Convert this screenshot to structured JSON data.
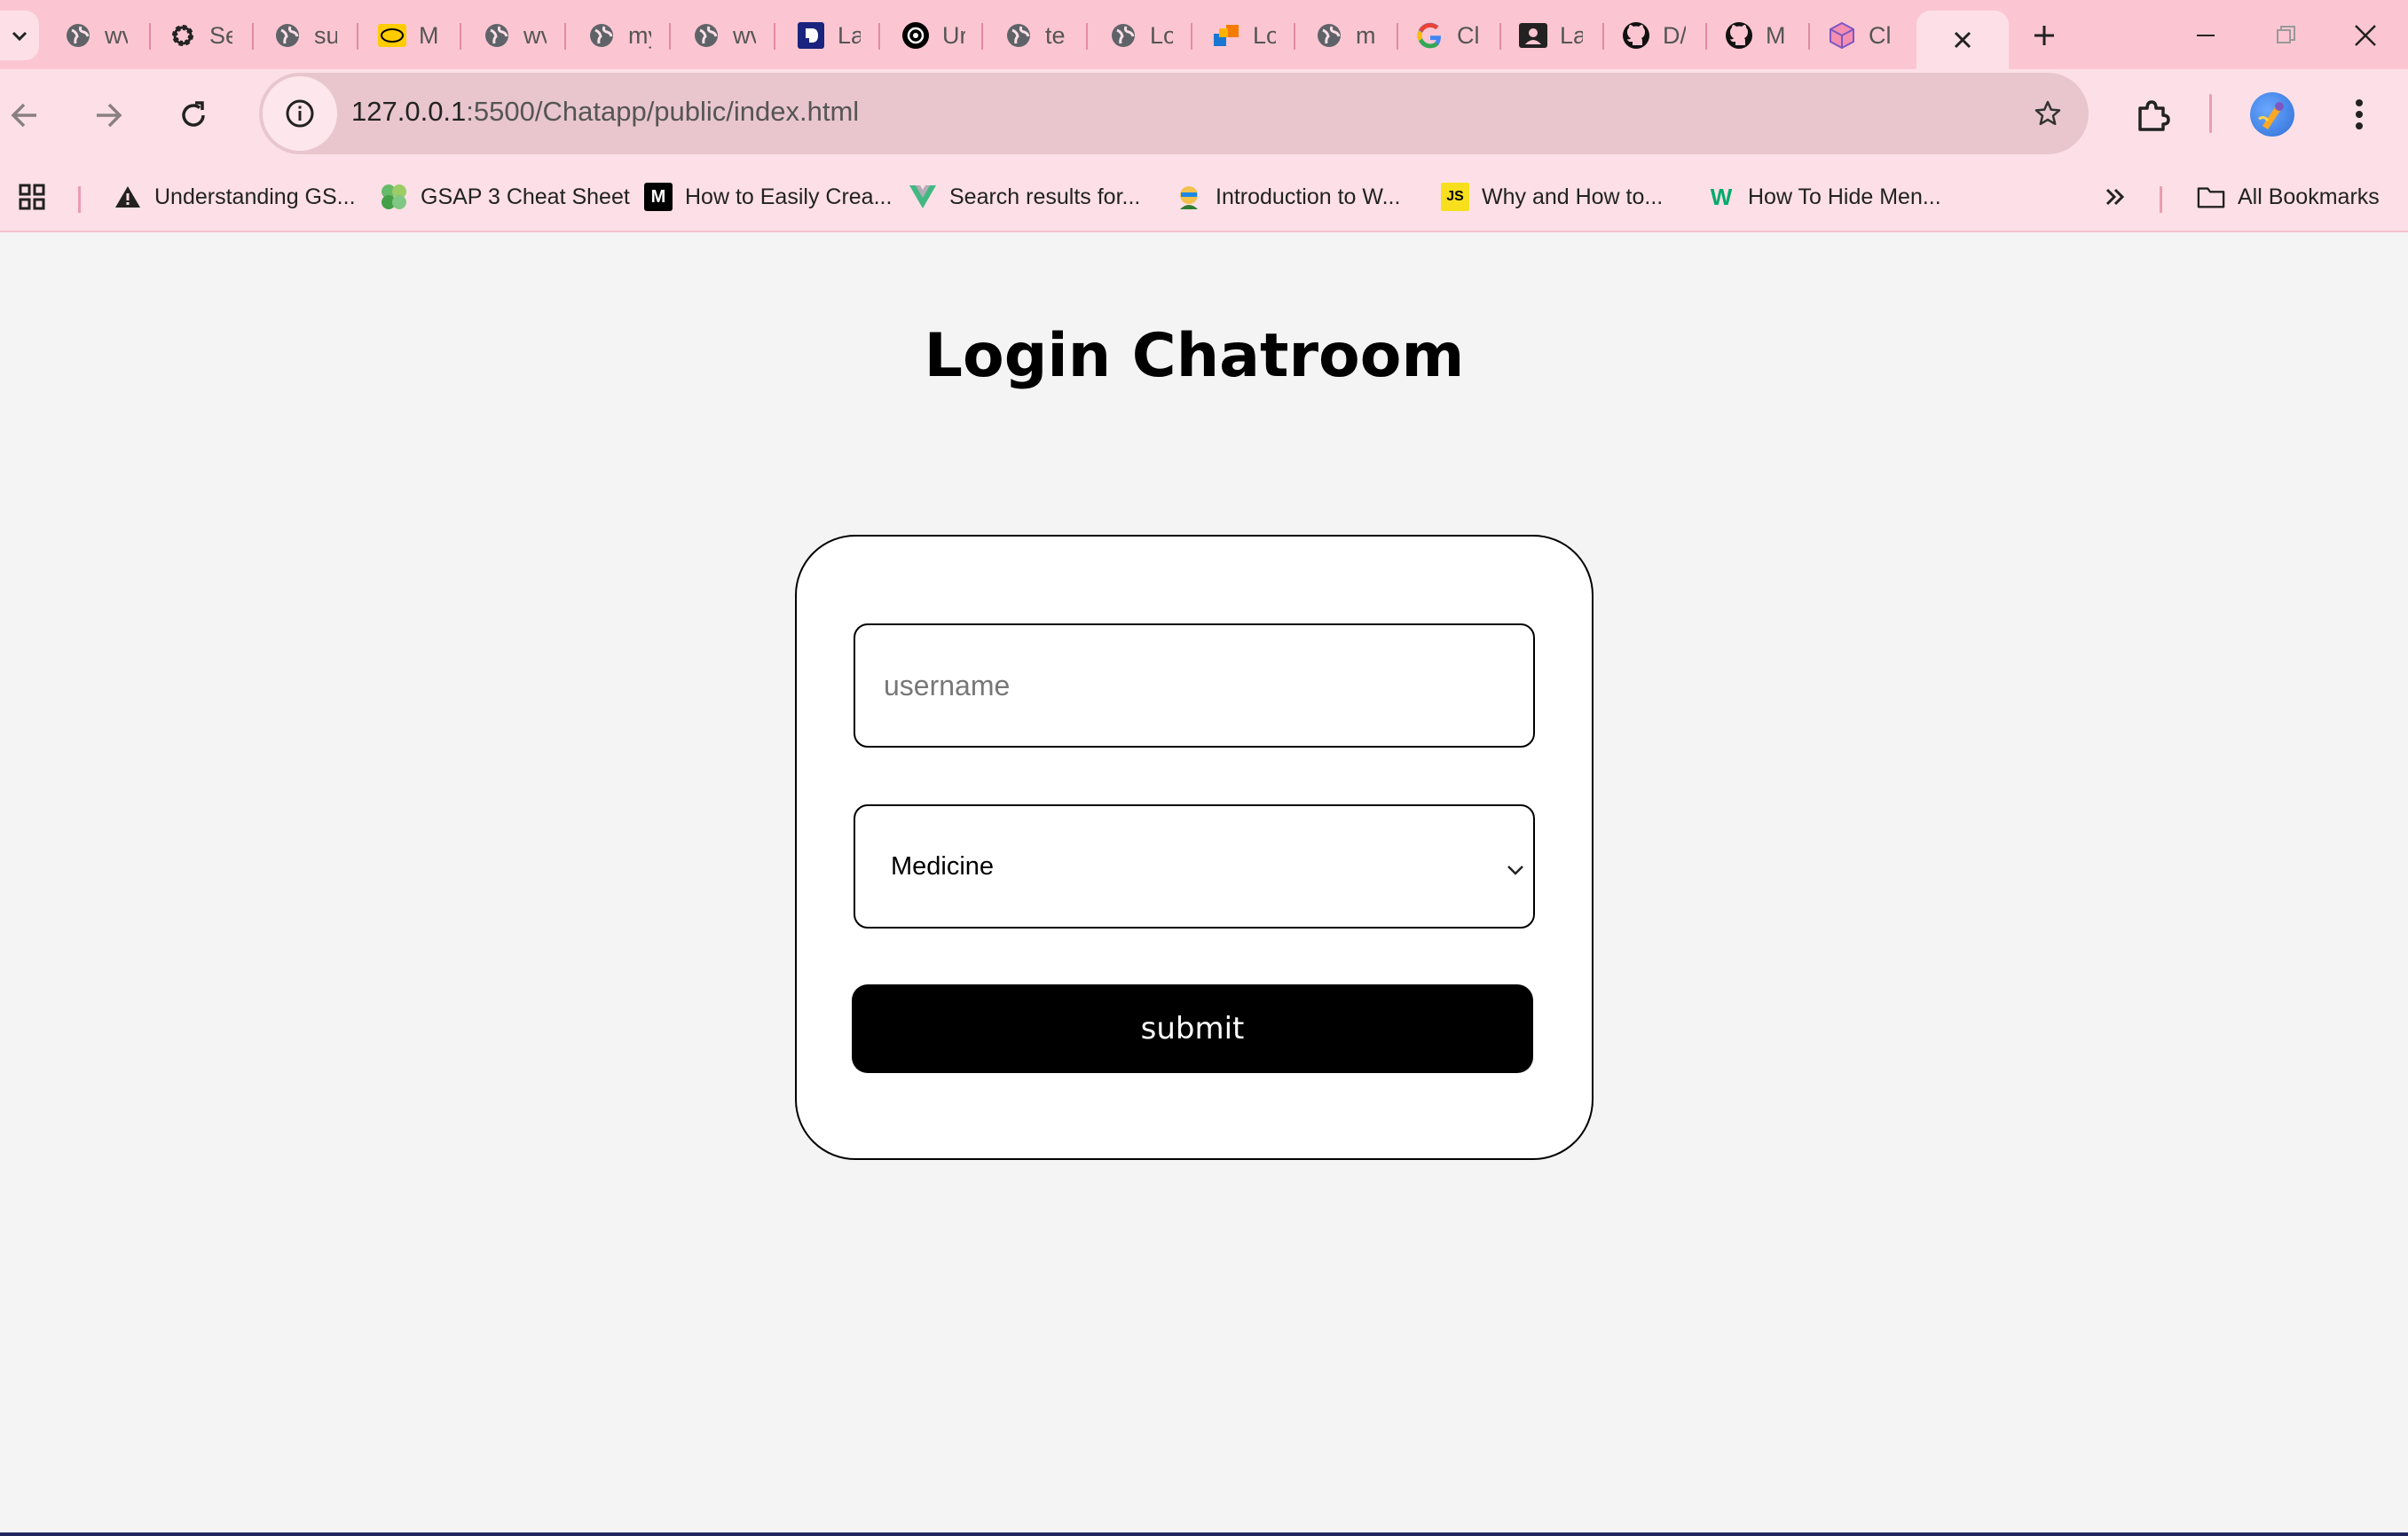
{
  "browser": {
    "tabs": [
      {
        "title": "wv",
        "icon": "globe-icon"
      },
      {
        "title": "Se",
        "icon": "gear-icon"
      },
      {
        "title": "su",
        "icon": "globe-icon"
      },
      {
        "title": "M",
        "icon": "mtn-icon"
      },
      {
        "title": "wv",
        "icon": "globe-icon"
      },
      {
        "title": "my",
        "icon": "globe-icon"
      },
      {
        "title": "wv",
        "icon": "globe-icon"
      },
      {
        "title": "La",
        "icon": "d-logo-icon"
      },
      {
        "title": "Ur",
        "icon": "openai-icon"
      },
      {
        "title": "te",
        "icon": "globe-icon"
      },
      {
        "title": "Lo",
        "icon": "globe-icon"
      },
      {
        "title": "Lo",
        "icon": "cubes-icon"
      },
      {
        "title": "m",
        "icon": "globe-icon"
      },
      {
        "title": "Cl",
        "icon": "google-icon"
      },
      {
        "title": "La",
        "icon": "contact-card-icon"
      },
      {
        "title": "D/",
        "icon": "github-icon"
      },
      {
        "title": "M",
        "icon": "github-icon"
      },
      {
        "title": "Cl",
        "icon": "box-icon"
      }
    ],
    "url_host": "127.0.0.1",
    "url_path": ":5500/Chatapp/public/index.html",
    "bookmarks": [
      {
        "label": "Understanding GS...",
        "icon": "warning-icon"
      },
      {
        "label": "GSAP 3 Cheat Sheet",
        "icon": "gsap-icon"
      },
      {
        "label": "How to Easily Crea...",
        "icon": "medium-icon"
      },
      {
        "label": "Search results for...",
        "icon": "vue-icon"
      },
      {
        "label": "Introduction to W...",
        "icon": "avatar-icon"
      },
      {
        "label": "Why and How to...",
        "icon": "js-icon"
      },
      {
        "label": "How To Hide Men...",
        "icon": "w3-icon"
      }
    ],
    "all_bookmarks_label": "All Bookmarks",
    "medium_glyph": "M",
    "js_glyph": "JS",
    "w3_glyph": "W"
  },
  "page": {
    "title": "Login Chatroom",
    "username_placeholder": "username",
    "username_value": "",
    "room_selected": "Medicine",
    "submit_label": "submit"
  },
  "colors": {
    "tabstrip": "#fbc6d2",
    "toolbar": "#fde0e7",
    "page_bg": "#f4f4f4",
    "button_bg": "#000000"
  }
}
